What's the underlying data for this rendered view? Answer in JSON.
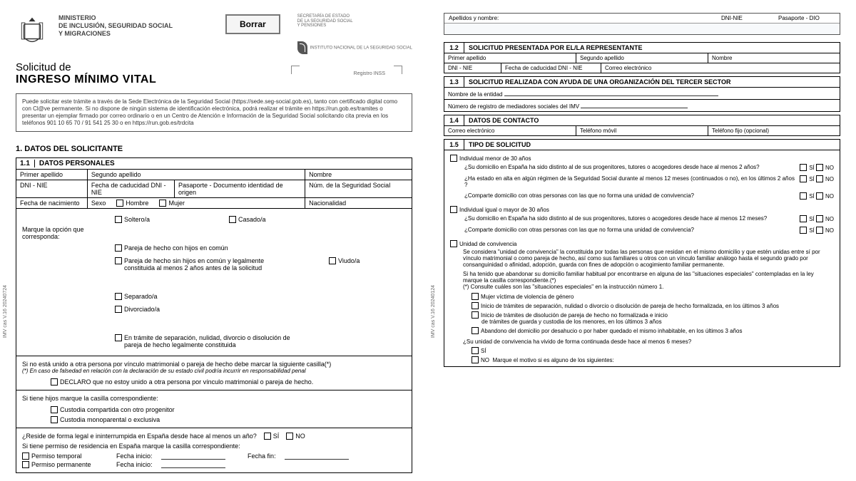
{
  "header": {
    "ministry_line1": "MINISTERIO",
    "ministry_line2": "DE INCLUSIÓN, SEGURIDAD SOCIAL",
    "ministry_line3": "Y MIGRACIONES",
    "borrar": "Borrar",
    "secretaria": "SECRETARÍA DE ESTADO DE LA SEGURIDAD SOCIAL Y PENSIONES",
    "ss_label": "INSTITUTO NACIONAL DE LA SEGURIDAD SOCIAL",
    "title1": "Solicitud de",
    "title2": "INGRESO MÍNIMO VITAL",
    "registro": "Registro INSS"
  },
  "info_box": "Puede solicitar este trámite a través de la Sede Electrónica de la Seguridad Social (https://sede.seg-social.gob.es), tanto con certificado digital como con Cl@ve permanente. Si no dispone de ningún sistema de identificación electrónica, podrá realizar el trámite en https://run.gob.es/tramites o presentar un ejemplar firmado por correo ordinario o en un Centro de Atención e Información de la Seguridad Social solicitando cita previa en los teléfonos 901 10 65 70 / 91 541 25 30 o en https://run.gob.es/trdcita",
  "section1": {
    "title": "1.  DATOS DEL SOLICITANTE",
    "s11": {
      "num": "1.1",
      "title": "DATOS PERSONALES",
      "primer_apellido": "Primer apellido",
      "segundo_apellido": "Segundo apellido",
      "nombre": "Nombre",
      "dni": "DNI - NIE",
      "caducidad": "Fecha de caducidad DNI - NIE",
      "pasaporte": "Pasaporte - Documento identidad de origen",
      "nss": "Núm. de la Seguridad Social",
      "fecha_nac": "Fecha de nacimiento",
      "sexo": "Sexo",
      "hombre": "Hombre",
      "mujer": "Mujer",
      "nacionalidad": "Nacionalidad",
      "marque": "Marque la opción que corresponda:",
      "soltero": "Soltero/a",
      "casado": "Casado/a",
      "pareja_hijos": "Pareja de hecho con hijos en común",
      "pareja_sin_hijos": "Pareja de hecho sin hijos en común y legalmente constituida al menos 2 años antes de la solicitud",
      "viudo": "Viudo/a",
      "separado": "Separado/a",
      "divorciado": "Divorciado/a",
      "tramite_sep": "En trámite de separación, nulidad, divorcio o disolución de pareja de hecho legalmente constituida",
      "no_unido_text": "Si no está unido a otra persona por vínculo matrimonial o pareja de hecho debe marcar la siguiente casilla(*)",
      "no_unido_nota": "(*) En caso de falsedad en relación con la declaración de su estado civil podría incurrir en responsabilidad penal",
      "declaro": "DECLARO que no estoy unido a otra persona por vínculo matrimonial o pareja de hecho.",
      "hijos_text": "Si tiene hijos marque la casilla correspondiente:",
      "custodia_comp": "Custodia compartida con otro progenitor",
      "custodia_mono": "Custodia monoparental o exclusiva",
      "reside_q": "¿Reside de forma legal e ininterrumpida en España desde hace al menos un año?",
      "permiso_text": "Si tiene permiso de residencia en España marque la casilla correspondiente:",
      "permiso_temp": "Permiso temporal",
      "permiso_perm": "Permiso permanente",
      "fecha_inicio": "Fecha inicio:",
      "fecha_fin": "Fecha fin:"
    }
  },
  "page2": {
    "top": {
      "apellidos": "Apellidos y nombre:",
      "dni": "DNI-NIE",
      "pasaporte": "Pasaporte - DIO"
    },
    "s12": {
      "num": "1.2",
      "title": "SOLICITUD PRESENTADA POR EL/LA REPRESENTANTE",
      "primer": "Primer apellido",
      "segundo": "Segundo apellido",
      "nombre": "Nombre",
      "dni": "DNI - NIE",
      "caducidad": "Fecha de caducidad DNI - NIE",
      "correo": "Correo electrónico"
    },
    "s13": {
      "num": "1.3",
      "title": "SOLICITUD REALIZADA CON AYUDA DE UNA ORGANIZACIÓN DEL TERCER SECTOR",
      "entidad": "Nombre de la entidad",
      "registro": "Número de registro de mediadores sociales del IMV"
    },
    "s14": {
      "num": "1.4",
      "title": "DATOS DE CONTACTO",
      "correo": "Correo electrónico",
      "movil": "Teléfono móvil",
      "fijo": "Teléfono fijo (opcional)"
    },
    "s15": {
      "num": "1.5",
      "title": "TIPO DE SOLICITUD",
      "ind_menor": "Individual menor de 30 años",
      "q_dom2": "¿Su domicilio en España ha sido distinto al de sus progenitores, tutores o acogedores desde hace al menos 2 años?",
      "q_alta": "¿Ha estado en alta en algún régimen de la Seguridad Social durante al menos 12 meses (continuados o no), en los últimos 2 años ?",
      "q_comparte": "¿Comparte domicilio con otras personas con las que no forma una unidad de convivencia?",
      "ind_mayor": "Individual igual o mayor de 30 años",
      "q_dom12": "¿Su domicilio en España ha sido distinto al de sus progenitores, tutores o acogedores desde hace al menos 12 meses?",
      "unidad": "Unidad de convivencia",
      "unidad_def": "Se considera \"unidad de convivencia\" la constituida por todas las personas que residan en el mismo domicilio y que estén unidas entre sí por vínculo matrimonial o como pareja de hecho, así como sus familiares u otros con un vínculo familiar análogo hasta el segundo grado por consanguinidad o afinidad, adopción, guarda con fines de adopción o acogimiento familiar permanente.",
      "abandono": "Si ha tenido que abandonar su domicilio familiar habitual por encontrarse en alguna de las \"situaciones especiales\" contempladas en la ley marque la casilla correspondiente.(*)",
      "consulte": "(*) Consulte cuáles son las \"situaciones especiales\" en la instrucción número 1.",
      "sit1": "Mujer víctima de violencia de género",
      "sit2": "Inicio de trámites de separación, nulidad o divorcio o disolución de pareja de hecho formalizada, en los últimos 3 años",
      "sit3a": "Inicio de trámites de disolución de pareja de hecho no formalizada e inicio",
      "sit3b": "de trámites de guarda y custodia de los menores, en los últimos 3 años",
      "sit4": "Abandono del domicilio por desahucio o por haber quedado el mismo inhabitable, en los últimos 3 años",
      "q_6m": "¿Su unidad de convivencia ha vivido de forma continuada desde hace al menos 6 meses?",
      "no_motivo": "Marque el motivo si es alguno de los siguientes:"
    }
  },
  "common": {
    "si": "SÍ",
    "no": "NO"
  },
  "side_left": "IMV cas V.16     20240724",
  "side_right": "IMV cas V.16     20240124"
}
